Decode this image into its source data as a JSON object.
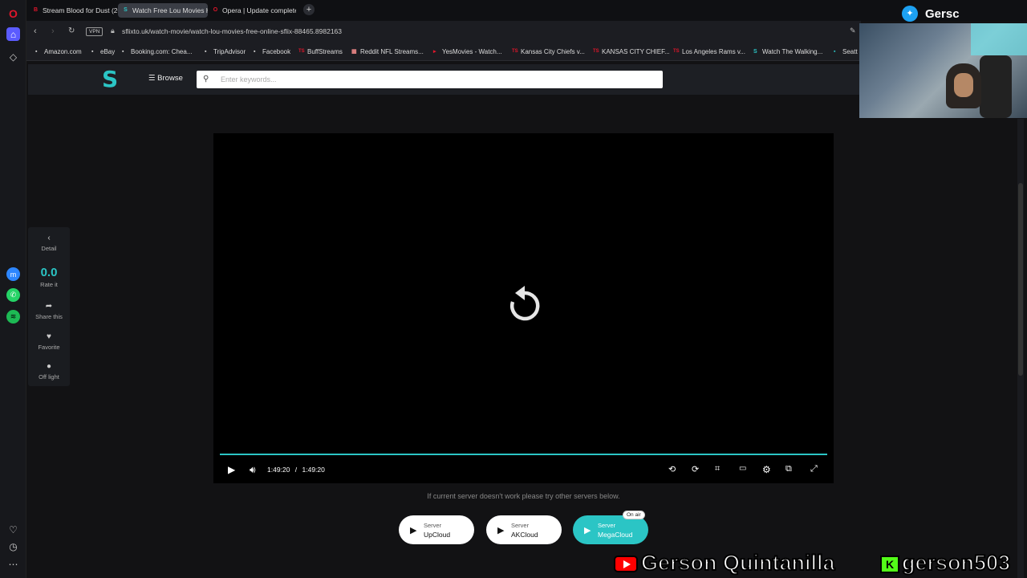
{
  "tabs": [
    {
      "label": "Stream Blood for Dust (20",
      "favicon": "B"
    },
    {
      "label": "Watch Free Lou Movies H",
      "favicon": "S"
    },
    {
      "label": "Opera | Update complete",
      "favicon": "O"
    }
  ],
  "newtab_label": "+",
  "address": {
    "vpn": "VPN",
    "url": "sflixto.uk/watch-movie/watch-lou-movies-free-online-sflix-88465.8982163"
  },
  "bookmarks": [
    {
      "label": "Amazon.com",
      "icon": "▪"
    },
    {
      "label": "eBay",
      "icon": "▪"
    },
    {
      "label": "Booking.com: Chea...",
      "icon": "▪"
    },
    {
      "label": "TripAdvisor",
      "icon": "▪"
    },
    {
      "label": "Facebook",
      "icon": "▪"
    },
    {
      "label": "BuffStreams",
      "icon": "TS"
    },
    {
      "label": "Reddit NFL Streams...",
      "icon": "▦"
    },
    {
      "label": "YesMovies - Watch...",
      "icon": "▸"
    },
    {
      "label": "Kansas City Chiefs v...",
      "icon": "TS"
    },
    {
      "label": "KANSAS CITY CHIEF...",
      "icon": "TS"
    },
    {
      "label": "Los Angeles Rams v...",
      "icon": "TS"
    },
    {
      "label": "Watch The Walking...",
      "icon": "S"
    },
    {
      "label": "Seatt",
      "icon": "▪"
    }
  ],
  "site": {
    "logo": "S",
    "browse_label": "Browse",
    "search_placeholder": "Enter keywords..."
  },
  "panel": {
    "detail": "Detail",
    "rating": "0.0",
    "rate_label": "Rate it",
    "share": "Share this",
    "favorite": "Favorite",
    "offlight": "Off light"
  },
  "player": {
    "current_time": "1:49:20",
    "separator": "/",
    "duration": "1:49:20",
    "progress": 1.0
  },
  "server_note": "If current server doesn't work please try other servers below.",
  "servers": [
    {
      "line1": "Server",
      "line2": "UpCloud"
    },
    {
      "line1": "Server",
      "line2": "AKCloud"
    },
    {
      "line1": "Server",
      "line2": "MegaCloud",
      "badge": "On air"
    }
  ],
  "overlay": {
    "twitter_name": "Gersc",
    "youtube_name": "Gerson Quintanilla",
    "kick_icon": "K",
    "kick_name": "gerson503"
  },
  "colors": {
    "accent": "#2bc5c5",
    "opera_red": "#e0162b"
  }
}
